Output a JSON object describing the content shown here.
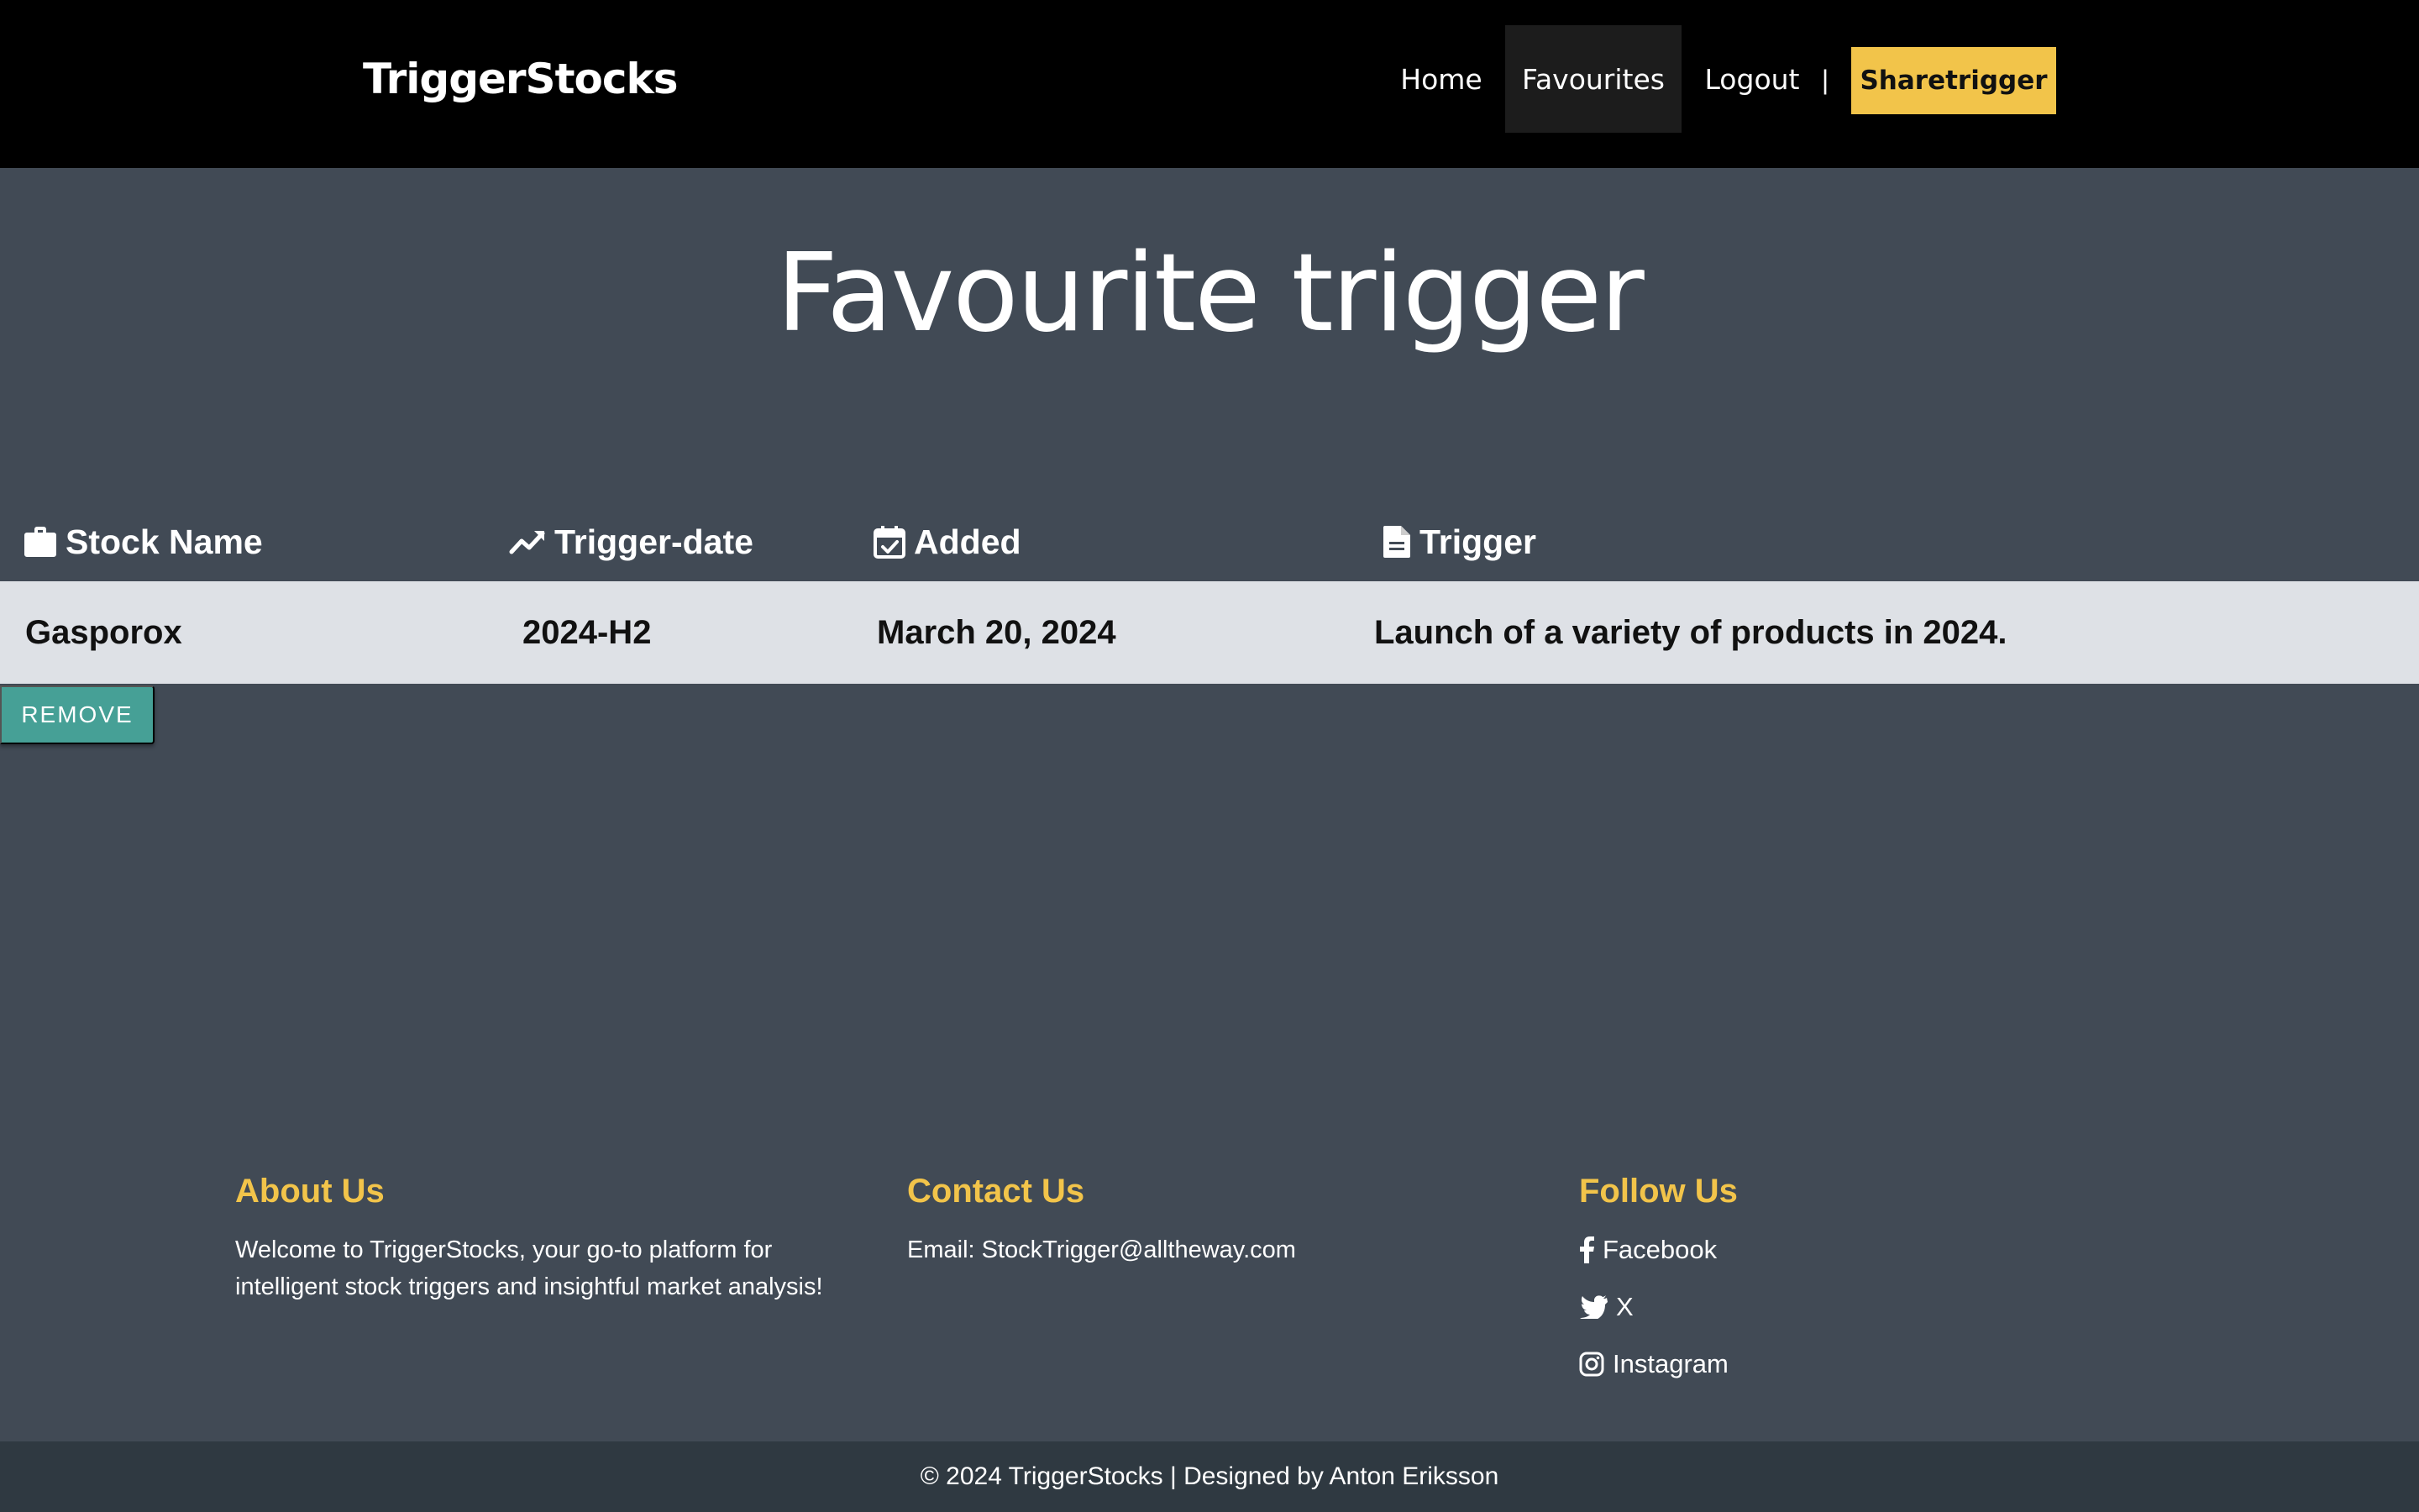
{
  "navbar": {
    "brand": "TriggerStocks",
    "links": [
      {
        "label": "Home"
      },
      {
        "label": "Favourites",
        "active": true
      },
      {
        "label": "Logout"
      }
    ],
    "separator": "|",
    "cta_label": "Sharetrigger"
  },
  "main": {
    "title": "Favourite trigger",
    "table": {
      "headers": [
        {
          "label": "Stock Name",
          "icon": "briefcase-icon"
        },
        {
          "label": "Trigger-date",
          "icon": "trending-up-icon"
        },
        {
          "label": "Added",
          "icon": "calendar-check-icon"
        },
        {
          "label": "Trigger",
          "icon": "document-icon"
        }
      ],
      "rows": [
        {
          "stock_name": "Gasporox",
          "trigger_date": "2024-H2",
          "added": "March 20, 2024",
          "trigger": "Launch of a variety of products in 2024."
        }
      ]
    },
    "remove_label": "REMOVE"
  },
  "footer": {
    "about": {
      "heading": "About Us",
      "text": "Welcome to TriggerStocks, your go-to platform for intelligent stock triggers and insightful market analysis!"
    },
    "contact": {
      "heading": "Contact Us",
      "email": "Email: StockTrigger@alltheway.com"
    },
    "follow": {
      "heading": "Follow Us",
      "links": [
        {
          "label": "Facebook",
          "icon": "facebook-icon"
        },
        {
          "label": "X",
          "icon": "twitter-icon"
        },
        {
          "label": "Instagram",
          "icon": "instagram-icon"
        }
      ]
    },
    "copyright": "© 2024 TriggerStocks | Designed by Anton Eriksson"
  },
  "colors": {
    "page_bg": "#414a55",
    "navbar_bg": "#000000",
    "accent_yellow": "#f2c44a",
    "row_bg": "#dee1e6",
    "remove_button": "#46a096",
    "copyright_bg": "#2f3941"
  }
}
